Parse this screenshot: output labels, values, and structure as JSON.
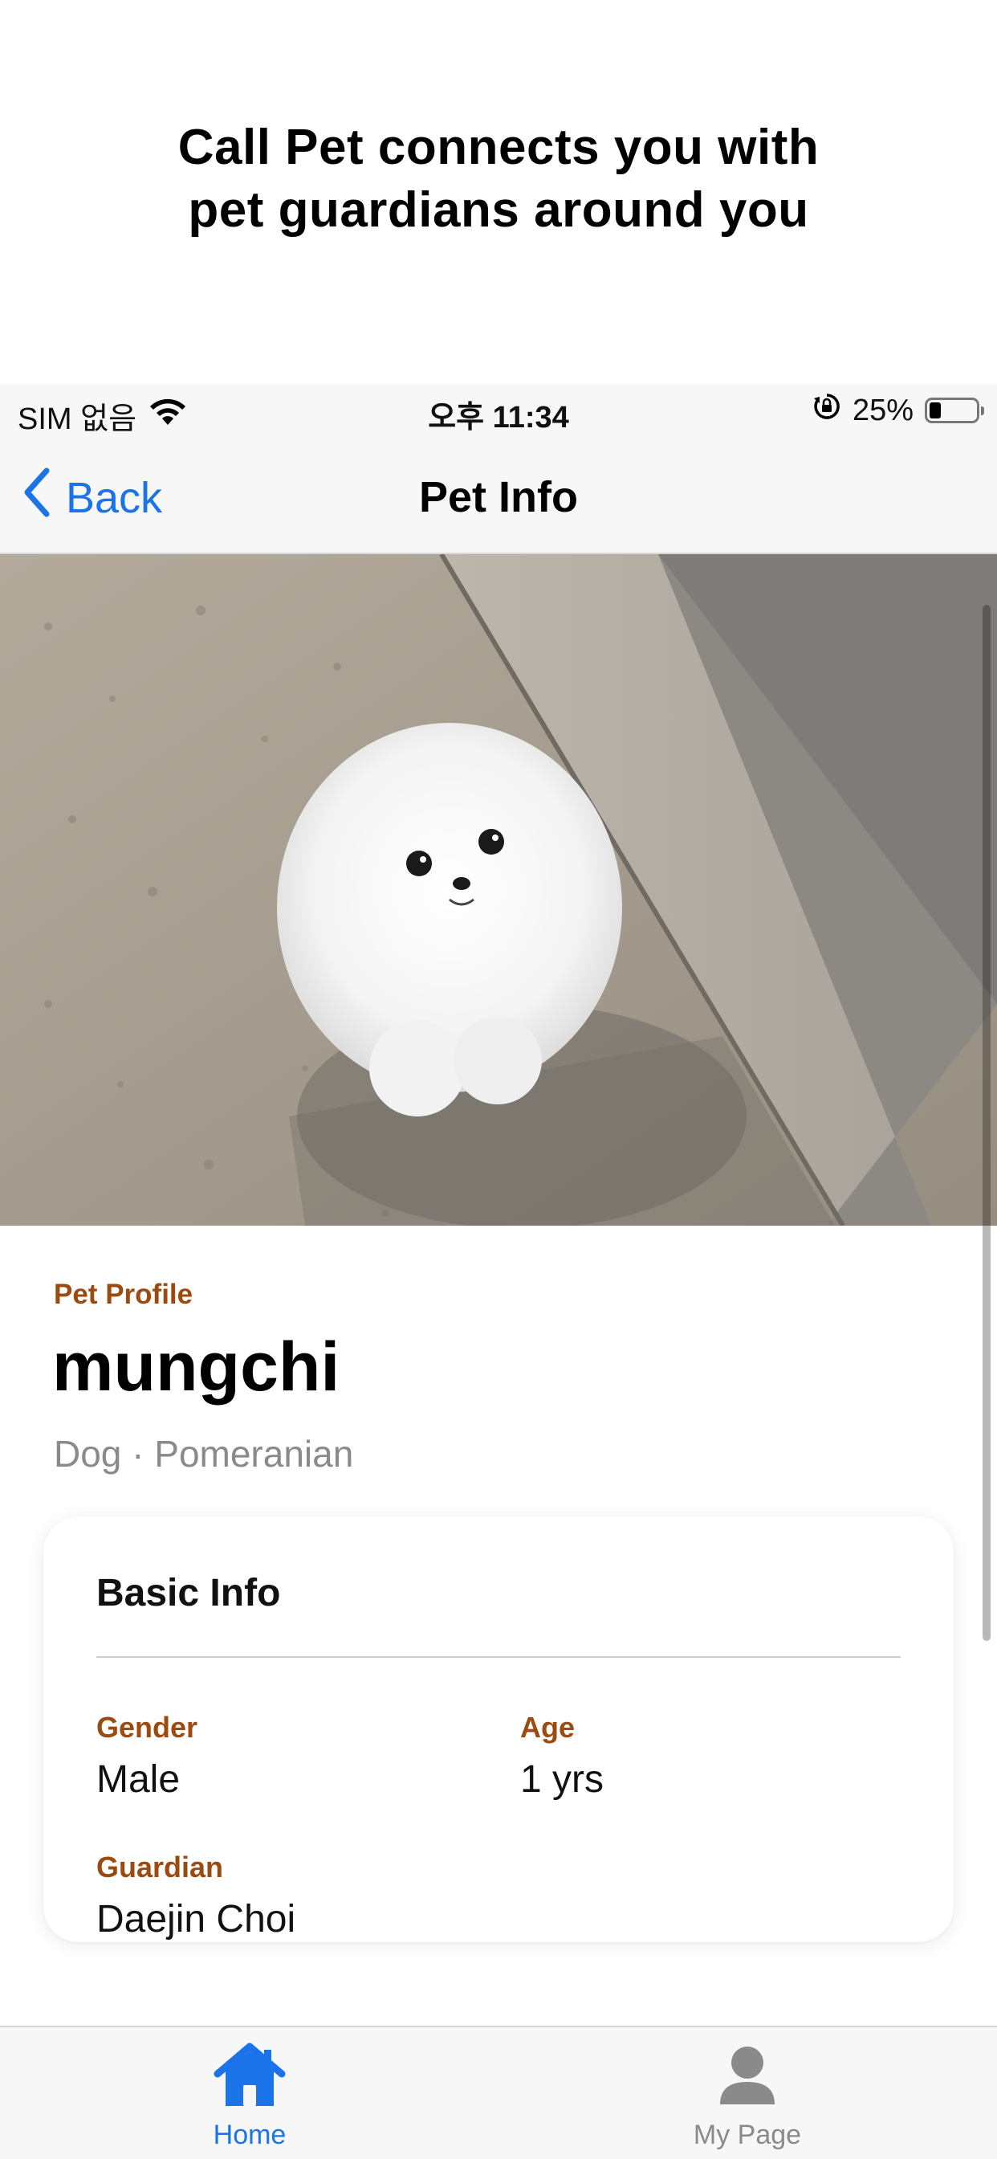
{
  "promo": {
    "line1": "Call Pet connects you with",
    "line2": "pet guardians around you"
  },
  "statusbar": {
    "carrier": "SIM 없음",
    "time": "오후 11:34",
    "battery_percent_label": "25%",
    "battery_level": 0.25,
    "icons": [
      "wifi-icon",
      "orientation-lock-icon",
      "battery-icon"
    ]
  },
  "navbar": {
    "back_label": "Back",
    "title": "Pet Info"
  },
  "pet": {
    "section_label": "Pet Profile",
    "name": "mungchi",
    "species": "Dog · Pomeranian"
  },
  "basic_info": {
    "title": "Basic Info",
    "gender_label": "Gender",
    "gender_value": "Male",
    "age_label": "Age",
    "age_value": "1 yrs",
    "guardian_label": "Guardian",
    "guardian_value": "Daejin Choi"
  },
  "tabbar": {
    "tabs": [
      {
        "label": "Home",
        "icon": "home-icon",
        "active": true
      },
      {
        "label": "My Page",
        "icon": "person-icon",
        "active": false
      }
    ]
  },
  "colors": {
    "accent_blue": "#1a73e8",
    "label_brown": "#9b4a10",
    "inactive_gray": "#8a8a8a"
  }
}
